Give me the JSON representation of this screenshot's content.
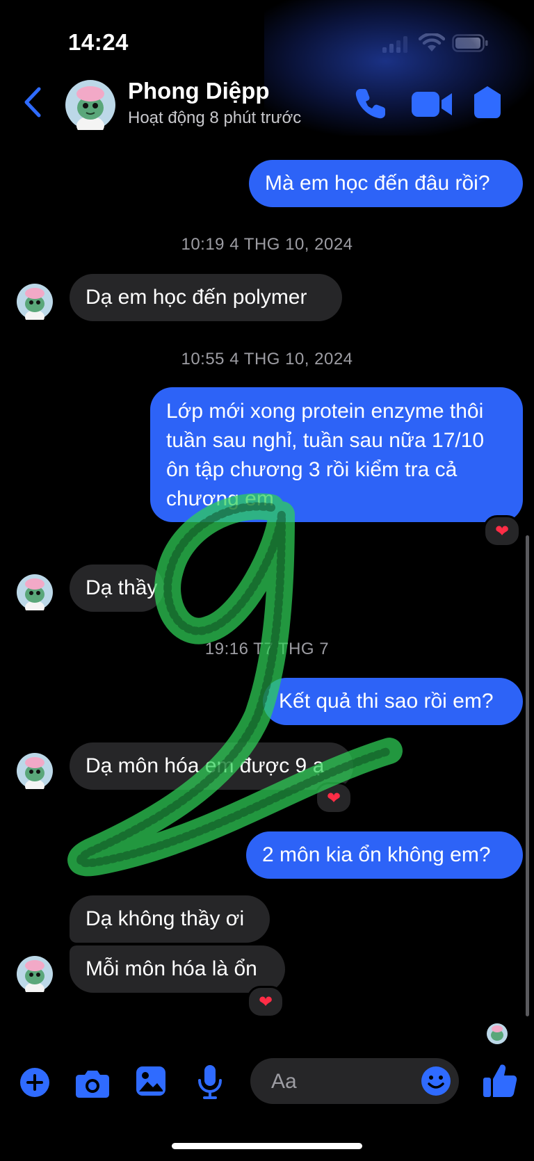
{
  "status_bar": {
    "time": "14:24"
  },
  "header": {
    "contact_name": "Phong Diệpp",
    "contact_status": "Hoạt động 8 phút trước"
  },
  "chat": {
    "msg1": {
      "text": "Mà em học đến đâu rồi?"
    },
    "ts1": "10:19 4 THG 10, 2024",
    "msg2": {
      "text": "Dạ em học đến polymer"
    },
    "ts2": "10:55 4 THG 10, 2024",
    "msg3": {
      "text": "Lớp mới xong protein enzyme thôi tuần sau nghỉ, tuần sau nữa 17/10 ôn tập chương 3 rồi kiểm tra cả chương em"
    },
    "msg4": {
      "text": "Dạ thầy"
    },
    "ts3": "19:16 T7 THG 7",
    "msg5": {
      "text": "Kết quả thi sao rồi em?"
    },
    "msg6": {
      "text": "Dạ môn hóa em được 9 ạ"
    },
    "msg7": {
      "text": "2 môn kia ổn không em?"
    },
    "msg8": {
      "text": "Dạ không thầy ơi"
    },
    "msg9": {
      "text": "Mỗi môn hóa là ổn"
    },
    "reaction_glyph": "❤"
  },
  "composer": {
    "placeholder": "Aa"
  },
  "colors": {
    "outgoing_bubble": "#2d63f7",
    "incoming_bubble": "#262628",
    "accent": "#2f6bff",
    "scribble": "#2fd158"
  }
}
